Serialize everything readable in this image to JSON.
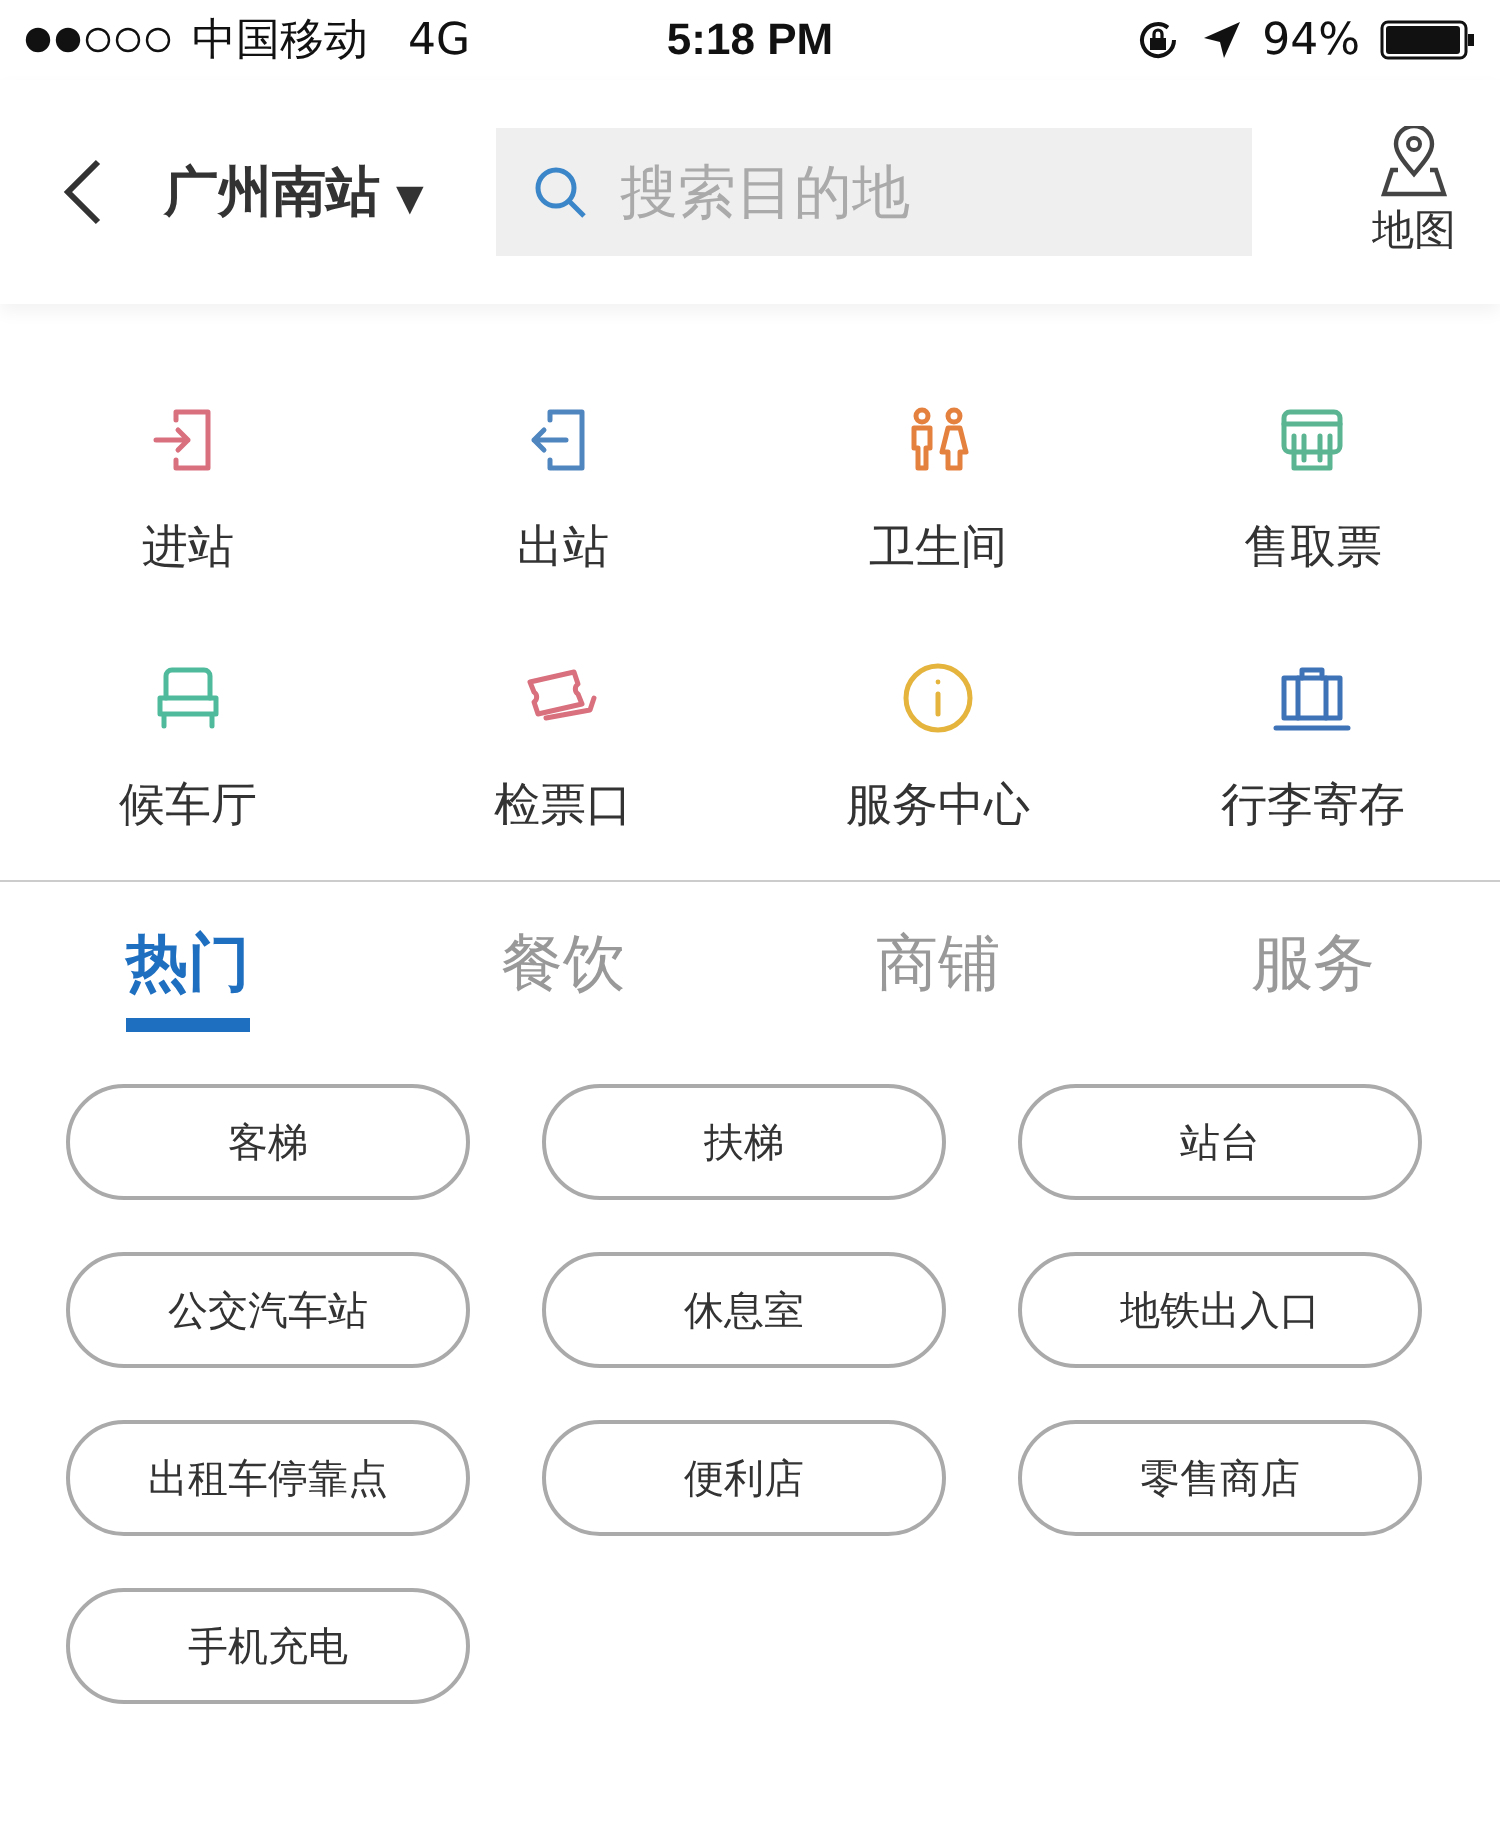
{
  "status_bar": {
    "carrier": "中国移动",
    "network": "4G",
    "time": "5:18 PM",
    "battery": "94%"
  },
  "header": {
    "station": "广州南站",
    "dropdown": "▼",
    "search": {
      "placeholder": "搜索目的地"
    },
    "map_label": "地图"
  },
  "facilities": [
    {
      "kind": "enter",
      "label": "进站",
      "color": "#d9707e"
    },
    {
      "kind": "exit",
      "label": "出站",
      "color": "#4f86c0"
    },
    {
      "kind": "restroom",
      "label": "卫生间",
      "color": "#e5813f"
    },
    {
      "kind": "ticket",
      "label": "售取票",
      "color": "#5bb592"
    },
    {
      "kind": "waiting",
      "label": "候车厅",
      "color": "#4fbb9c"
    },
    {
      "kind": "gate",
      "label": "检票口",
      "color": "#d9707e"
    },
    {
      "kind": "info",
      "label": "服务中心",
      "color": "#e4b43c"
    },
    {
      "kind": "luggage",
      "label": "行李寄存",
      "color": "#3f73b8"
    }
  ],
  "tabs": [
    {
      "label": "热门",
      "selected": true
    },
    {
      "label": "餐饮",
      "selected": false
    },
    {
      "label": "商铺",
      "selected": false
    },
    {
      "label": "服务",
      "selected": false
    }
  ],
  "chips": [
    "客梯",
    "扶梯",
    "站台",
    "公交汽车站",
    "休息室",
    "地铁出入口",
    "出租车停靠点",
    "便利店",
    "零售商店",
    "手机充电"
  ]
}
